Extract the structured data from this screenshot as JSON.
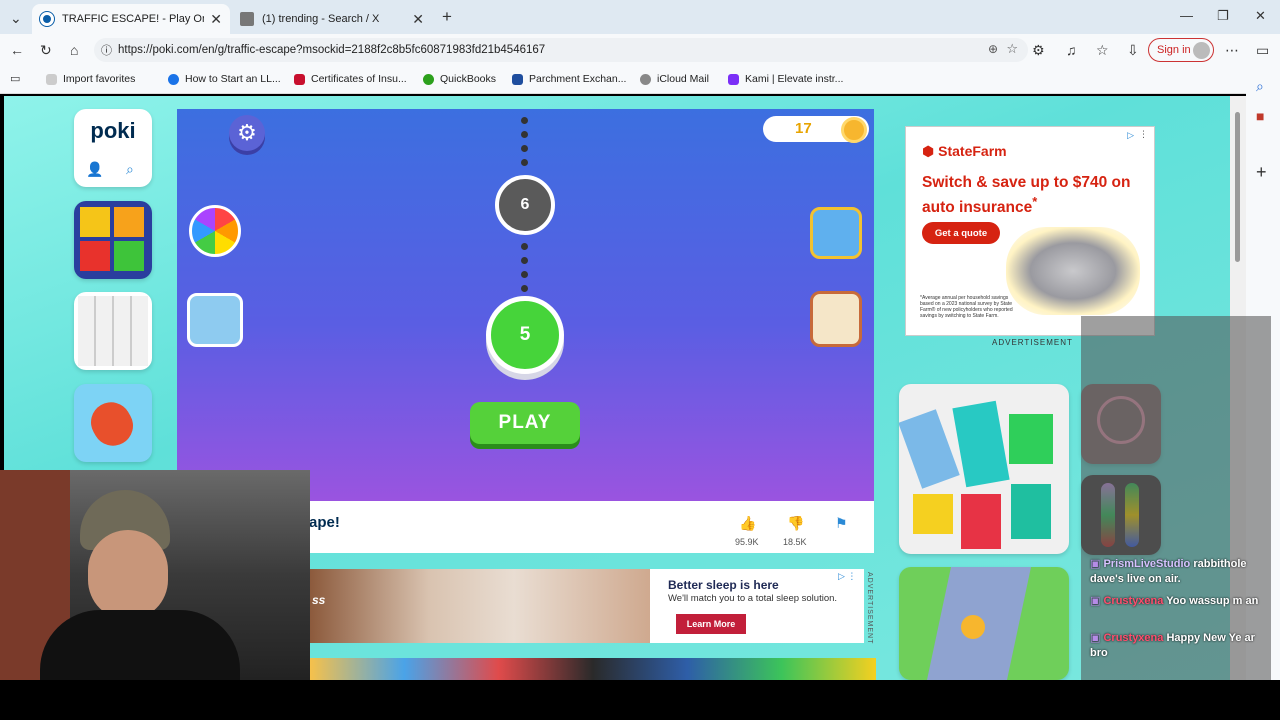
{
  "browser": {
    "tabs": [
      {
        "title": "TRAFFIC ESCAPE! - Play Online for",
        "active": true
      },
      {
        "title": "(1) trending - Search / X",
        "active": false
      }
    ],
    "new_tab": "+",
    "url": "https://poki.com/en/g/traffic-escape?msockid=2188f2c8b5fc60871983fd21b4546167",
    "sign_in": "Sign in",
    "favorites": [
      "Import favorites",
      "How to Start an LL...",
      "Certificates of Insu...",
      "QuickBooks",
      "Parchment Exchan...",
      "iCloud Mail",
      "Kami | Elevate instr..."
    ]
  },
  "site": {
    "logo": "poki"
  },
  "game": {
    "coins": "17",
    "level_current": "5",
    "level_next": "6",
    "play_label": "PLAY",
    "title_fragment": "ape!",
    "likes": "95.9K",
    "dislikes": "18.5K"
  },
  "ads": {
    "statefarm": {
      "brand": "StateFarm",
      "headline": "Switch & save up to $740 on auto insurance",
      "asterisk": "*",
      "cta": "Get a quote",
      "fine_print": "*Average annual per household savings based on a 2023 national survey by State Farm® of new policyholders who reported savings by switching to State Farm.",
      "label": "ADVERTISEMENT"
    },
    "sleep": {
      "headline": "Better sleep is here",
      "body": "We'll match you to a total sleep solution.",
      "cta": "Learn More",
      "prefix": "ss",
      "label": "ADVERTISEMENT"
    }
  },
  "chat": [
    {
      "user": "PrismLiveStudio",
      "message": "rabbithole dave's live on air.",
      "color": "#ffffff"
    },
    {
      "user": "Crustyxena",
      "message": "Yoo wassup m an",
      "color": "#ff4d6d"
    },
    {
      "user": "Crustyxena",
      "message": "Happy New Ye ar bro",
      "color": "#ff4d6d"
    }
  ]
}
